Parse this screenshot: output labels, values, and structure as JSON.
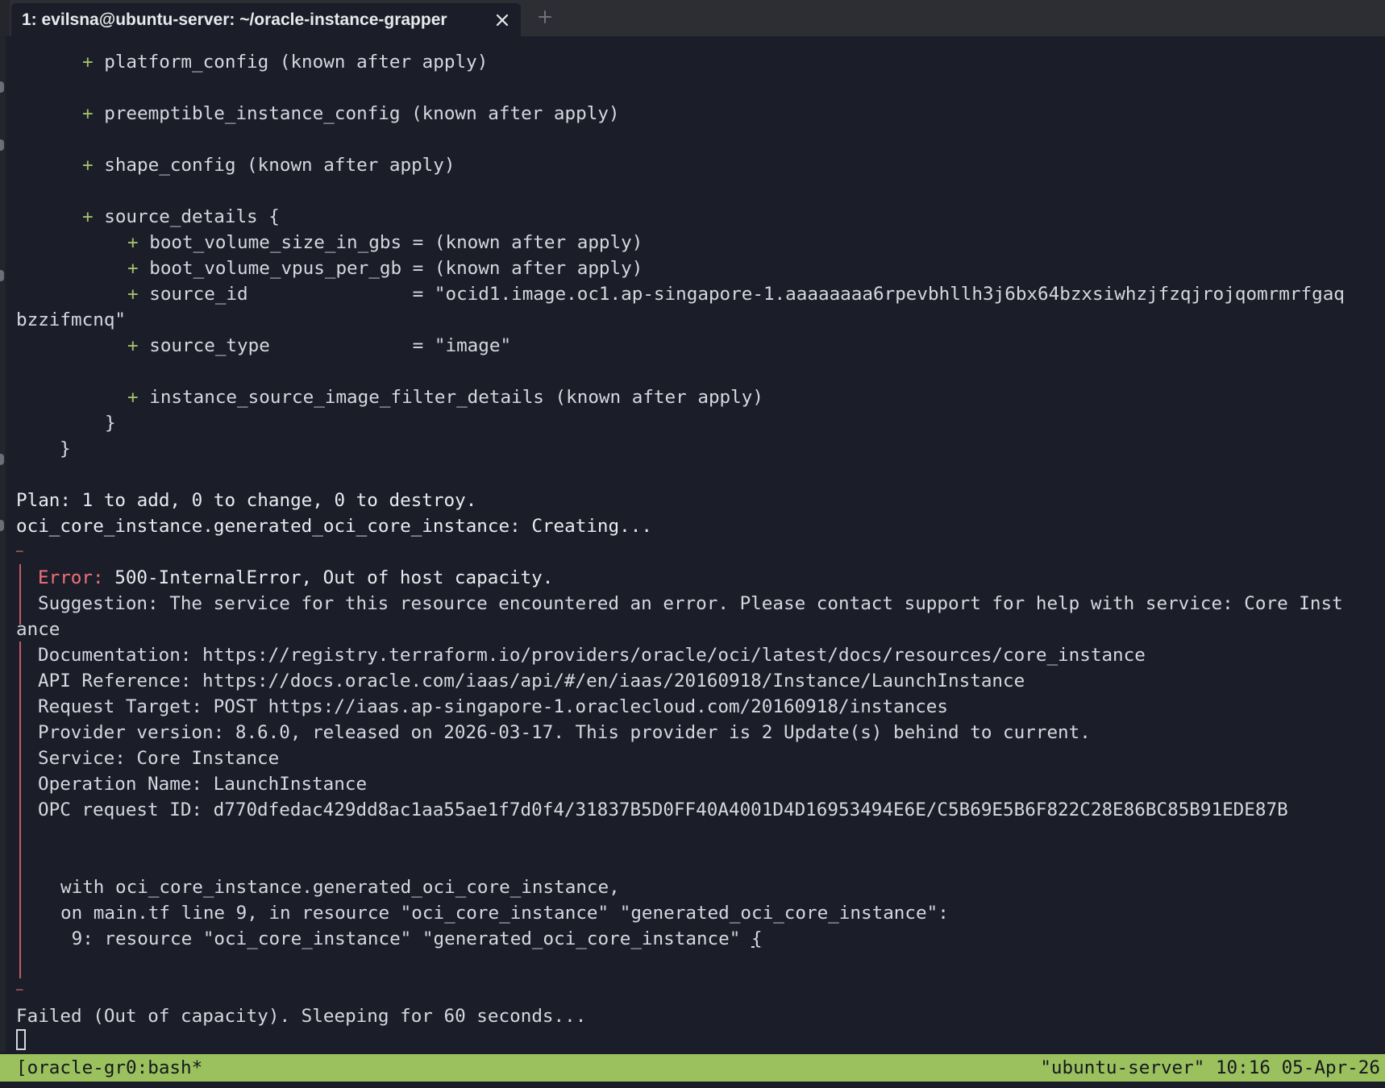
{
  "tabbar": {
    "tab_title": "1: evilsna@ubuntu-server: ~/oracle-instance-grapper",
    "close_icon": "close-icon",
    "new_tab_icon": "plus-icon"
  },
  "terminal": {
    "lines": {
      "l1_plus": "+",
      "l1_text": " platform_config (known after apply)",
      "l2_plus": "+",
      "l2_text": " preemptible_instance_config (known after apply)",
      "l3_plus": "+",
      "l3_text": " shape_config (known after apply)",
      "l4_plus": "+",
      "l4_text": " source_details {",
      "l5_plus": "+",
      "l5_text": " boot_volume_size_in_gbs = (known after apply)",
      "l6_plus": "+",
      "l6_text": " boot_volume_vpus_per_gb = (known after apply)",
      "l7_plus": "+",
      "l7_text": " source_id               = \"ocid1.image.oc1.ap-singapore-1.aaaaaaaa6rpevbhllh3j6bx64bzxsiwhzjfzqjrojqomrmrfgaq",
      "l8_text": "bzzifmcnq\"",
      "l9_plus": "+",
      "l9_text": " source_type             = \"image\"",
      "l10_plus": "+",
      "l10_text": " instance_source_image_filter_details (known after apply)",
      "l11_text": "}",
      "l12_text": "}",
      "plan": "Plan: 1 to add, 0 to change, 0 to destroy.",
      "creating": "oci_core_instance.generated_oci_core_instance: Creating...",
      "dash_top": "─",
      "error_label": "Error:",
      "error_msg": " 500-InternalError, Out of host capacity.",
      "suggestion": "Suggestion: The service for this resource encountered an error. Please contact support for help with service: Core Inst",
      "suggestion_wrap": "ance",
      "documentation": "Documentation: https://registry.terraform.io/providers/oracle/oci/latest/docs/resources/core_instance",
      "api_reference": "API Reference: https://docs.oracle.com/iaas/api/#/en/iaas/20160918/Instance/LaunchInstance",
      "request_target": "Request Target: POST https://iaas.ap-singapore-1.oraclecloud.com/20160918/instances",
      "provider_version": "Provider version: 8.6.0, released on 2026-03-17. This provider is 2 Update(s) behind to current.",
      "service": "Service: Core Instance",
      "operation": "Operation Name: LaunchInstance",
      "opc_request": "OPC request ID: d770dfedac429dd8ac1aa55ae1f7d0f4/31837B5D0FF40A4001D4D16953494E6E/C5B69E5B6F822C28E86BC85B91EDE87B",
      "with_line": "with oci_core_instance.generated_oci_core_instance,",
      "on_line": "on main.tf line 9, in resource \"oci_core_instance\" \"generated_oci_core_instance\":",
      "code_line": " 9: resource \"oci_core_instance\" \"generated_oci_core_instance\" ",
      "code_brace": "{",
      "dash_bottom": "─",
      "failed": "Failed (Out of capacity). Sleeping for 60 seconds..."
    }
  },
  "statusbar": {
    "left": "[oracle-gr0:bash*",
    "right": "\"ubuntu-server\" 10:16 05-Apr-26"
  },
  "colors": {
    "background": "#1b1e29",
    "plus_green": "#a3c06a",
    "error_red": "#f07178",
    "status_green": "#9bc15f"
  }
}
